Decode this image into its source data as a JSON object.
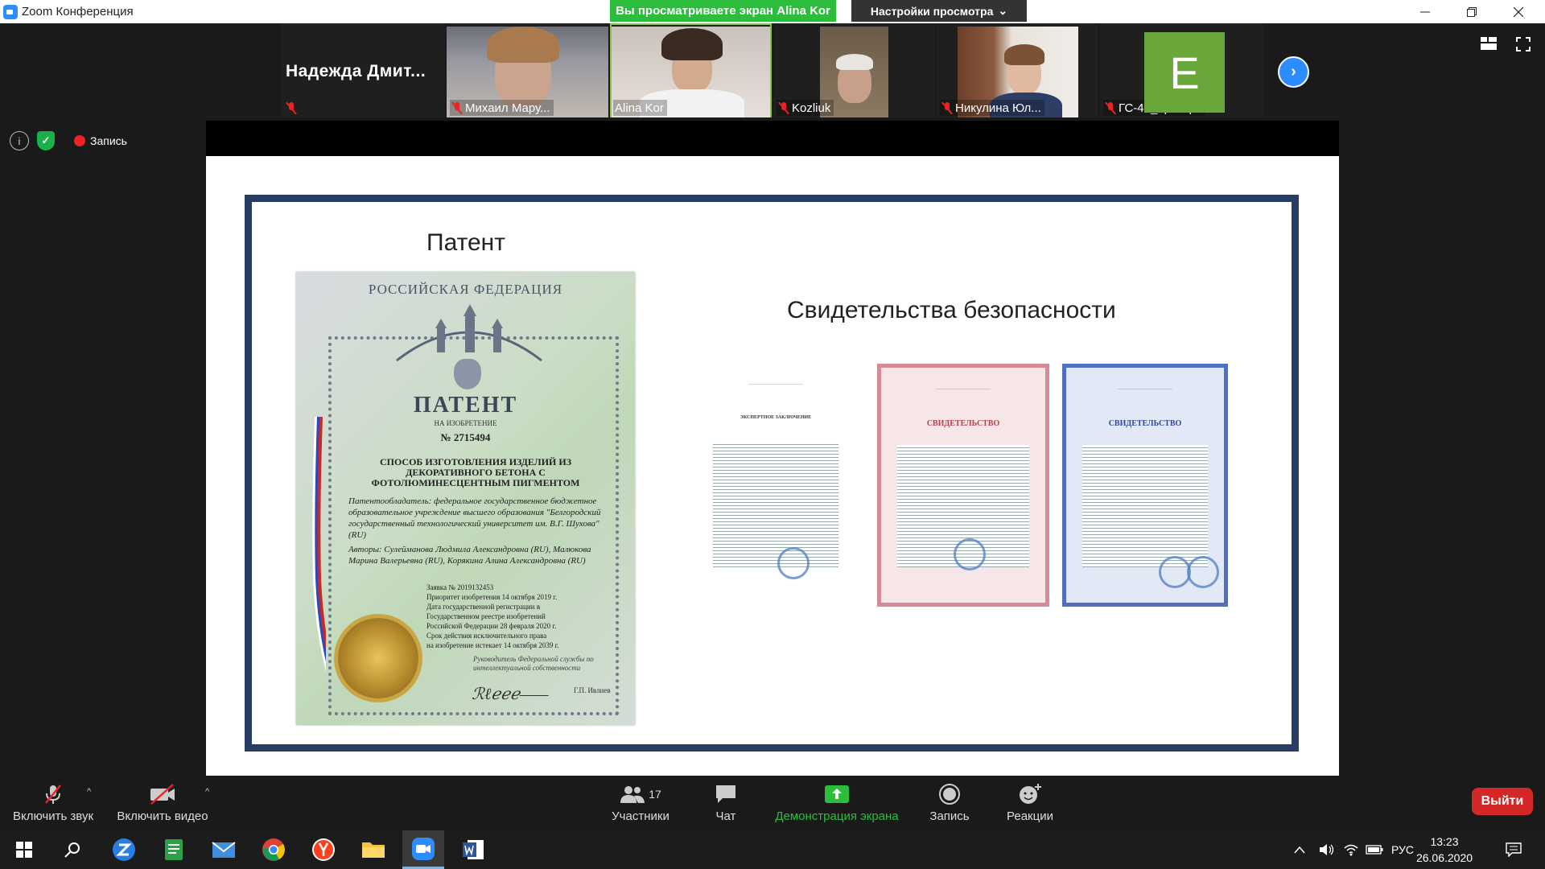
{
  "window": {
    "title": "Zoom Конференция"
  },
  "banner": {
    "sharing_text": "Вы просматриваете экран Alina Kor",
    "view_options": "Настройки просмотра"
  },
  "gallery": {
    "participants": [
      {
        "name": "Надежда  Дмит...",
        "muted": true,
        "video": false
      },
      {
        "name": "Михаил Мару...",
        "muted": true,
        "video": true
      },
      {
        "name": "Alina Kor",
        "muted": false,
        "video": true,
        "active": true
      },
      {
        "name": "Kozliuk",
        "muted": true,
        "video": true
      },
      {
        "name": "Никулина Юл...",
        "muted": true,
        "video": true
      },
      {
        "name": "ГС-41_Троиц...",
        "muted": true,
        "video": false,
        "avatar_letter": "E"
      }
    ]
  },
  "status": {
    "recording_label": "Запись"
  },
  "slide": {
    "patent_heading": "Патент",
    "certificates_heading": "Свидетельства безопасности",
    "patent_doc": {
      "country": "РОССИЙСКАЯ ФЕДЕРАЦИЯ",
      "title": "ПАТЕНТ",
      "subtitle": "НА ИЗОБРЕТЕНИЕ",
      "number": "№ 2715494",
      "invention": "СПОСОБ ИЗГОТОВЛЕНИЯ ИЗДЕЛИЙ ИЗ ДЕКОРАТИВНОГО БЕТОНА С ФОТОЛЮМИНЕСЦЕНТНЫМ ПИГМЕНТОМ",
      "holder": "Патентообладатель: федеральное государственное бюджетное образовательное учреждение высшего образования \"Белгородский государственный технологический университет им. В.Г. Шухова\" (RU)",
      "authors": "Авторы: Сулейманова Людмила Александровна (RU), Малюкова Марина Валерьевна (RU), Корякина Алина Александровна (RU)",
      "meta": [
        "Заявка № 2019132453",
        "Приоритет изобретения 14 октября 2019 г.",
        "Дата государственной регистрации в",
        "Государственном реестре изобретений",
        "Российской Федерации 28 февраля 2020 г.",
        "Срок действия исключительного права",
        "на изобретение истекает 14 октября 2039 г."
      ],
      "signatory_role": "Руководитель Федеральной службы по интеллектуальной собственности",
      "signatory_name": "Г.П. Ивлиев"
    },
    "certificates": [
      {
        "title": "ЭКСПЕРТНОЕ ЗАКЛЮЧЕНИЕ",
        "color": "#ffffff",
        "border": "#dddddd"
      },
      {
        "title": "СВИДЕТЕЛЬСТВО",
        "color": "#f6e6e8",
        "border": "#d88a94"
      },
      {
        "title": "СВИДЕТЕЛЬСТВО",
        "color": "#e3e8f6",
        "border": "#4f6fc4"
      }
    ]
  },
  "toolbar": {
    "unmute": "Включить звук",
    "start_video": "Включить видео",
    "participants": "Участники",
    "participants_count": "17",
    "chat": "Чат",
    "share_screen": "Демонстрация экрана",
    "record": "Запись",
    "reactions": "Реакции",
    "leave": "Выйти"
  },
  "taskbar": {
    "lang": "РУС",
    "time": "13:23",
    "date": "26.06.2020"
  },
  "colors": {
    "zoom_blue": "#2d8cff",
    "share_green": "#2dbd3c",
    "leave_red": "#d42828",
    "slide_frame": "#283d63"
  }
}
